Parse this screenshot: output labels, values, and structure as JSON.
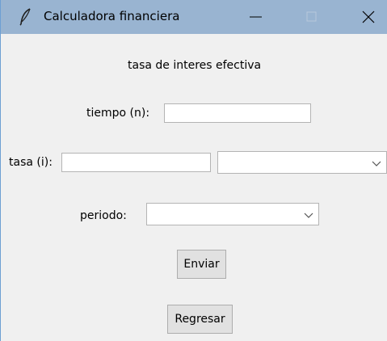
{
  "window": {
    "title": "Calculadora financiera",
    "controls": {
      "minimize": "minimize-icon",
      "maximize": "maximize-icon",
      "close": "close-icon"
    },
    "icon": "feather-icon"
  },
  "form": {
    "heading": "tasa de interes efectiva",
    "tiempo_label": "tiempo (n):",
    "tiempo_value": "",
    "tasa_label": "tasa (i):",
    "tasa_value": "",
    "tasa_unit_selected": "",
    "periodo_label": "periodo:",
    "periodo_selected": ""
  },
  "buttons": {
    "enviar": "Enviar",
    "regresar": "Regresar"
  },
  "colors": {
    "titlebar": "#99b4d1",
    "background": "#f0f0f0",
    "button": "#e1e1e1"
  }
}
